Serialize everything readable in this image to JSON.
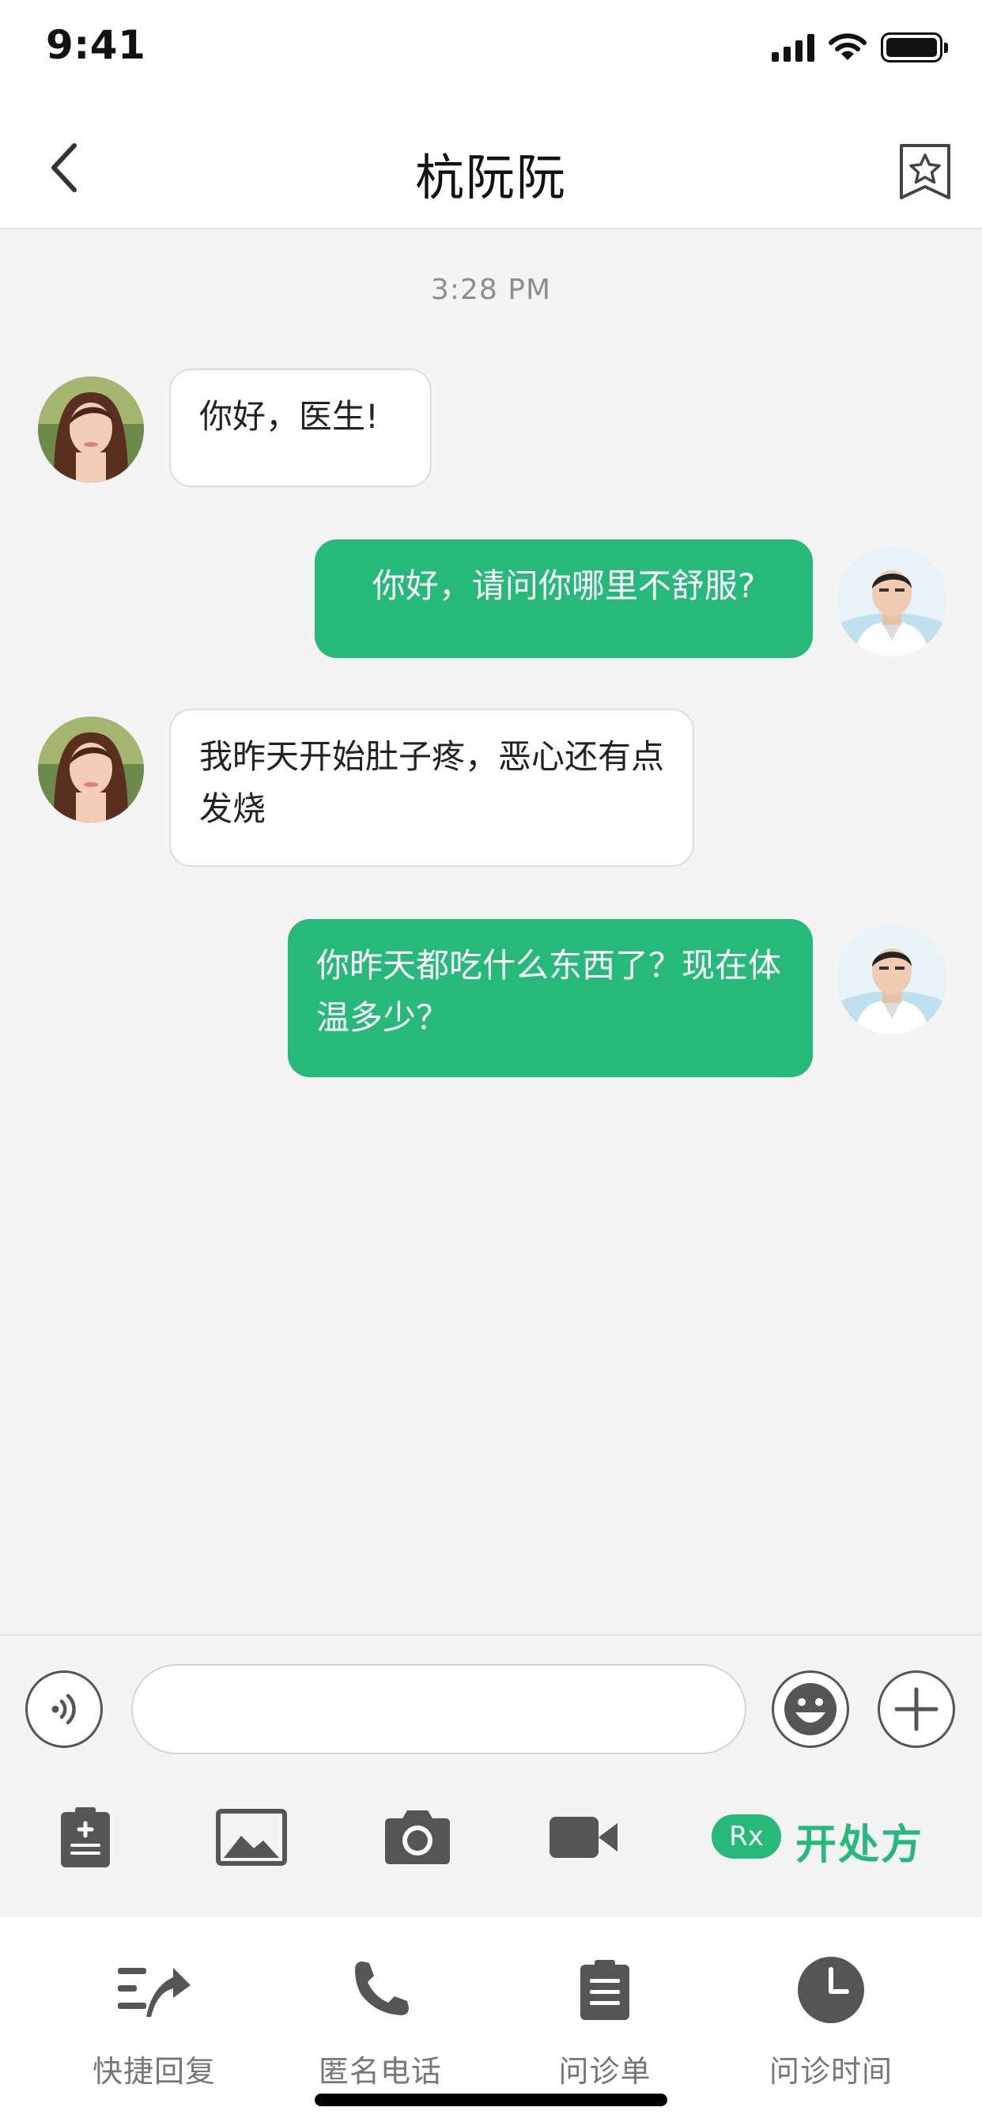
{
  "status_bar": {
    "time": "9:41"
  },
  "nav": {
    "title": "杭阮阮",
    "back_icon": "chevron-left-icon",
    "favorite_icon": "star-bookmark-icon"
  },
  "chat": {
    "timestamp": "3:28 PM",
    "messages": [
      {
        "sender": "patient",
        "text": "你好，医生!"
      },
      {
        "sender": "doctor",
        "text": "你好，请问你哪里不舒服?"
      },
      {
        "sender": "patient",
        "text": "我昨天开始肚子疼，恶心还有点发烧"
      },
      {
        "sender": "doctor",
        "text": "你昨天都吃什么东西了？现在体温多少？"
      }
    ]
  },
  "input": {
    "value": "",
    "placeholder": ""
  },
  "toolbar": {
    "prescribe_badge": "Rx",
    "prescribe_label": "开处方",
    "icons": [
      "clipboard-plus-icon",
      "image-icon",
      "camera-icon",
      "video-icon"
    ]
  },
  "bottom_nav": [
    {
      "label": "快捷回复",
      "icon": "quick-reply-icon"
    },
    {
      "label": "匿名电话",
      "icon": "phone-icon"
    },
    {
      "label": "问诊单",
      "icon": "clipboard-icon"
    },
    {
      "label": "问诊时间",
      "icon": "clock-icon"
    }
  ],
  "colors": {
    "accent": "#26b97a",
    "background": "#f4f4f4",
    "icon_gray": "#555555"
  }
}
